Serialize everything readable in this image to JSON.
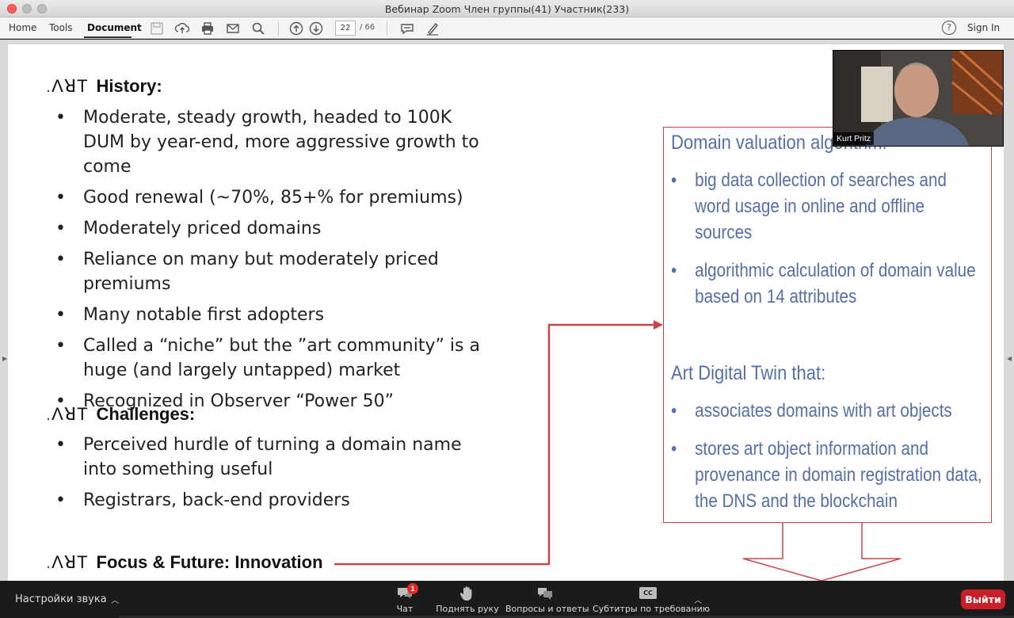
{
  "window": {
    "title": "Вебинар Zoom Член группы(41)  Участник(233)"
  },
  "toolbar": {
    "home": "Home",
    "tools": "Tools",
    "document": "Document",
    "page_current": "22",
    "page_total": "/ 66",
    "help": "?",
    "sign_in": "Sign In"
  },
  "slide": {
    "logo_text": "ΛꓤT",
    "history": {
      "heading": "History:",
      "bullets": [
        "Moderate, steady growth, headed to 100K DUM by year-end, more aggressive growth to come",
        "Good renewal (~70%, 85+% for premiums)",
        "Moderately priced domains",
        "Reliance on many but moderately priced premiums",
        "Many notable first adopters",
        "Called a “niche” but the ”art community” is a huge (and largely untapped) market",
        "Recognized in Observer “Power 50”"
      ]
    },
    "challenges": {
      "heading": "Challenges:",
      "bullets": [
        "Perceived hurdle of turning a domain name into something useful",
        "Registrars, back-end providers"
      ]
    },
    "focus": {
      "heading": "Focus & Future: Innovation"
    },
    "box": {
      "heading1": "Domain valuation algorithm:",
      "list1": [
        "big data collection of searches and word usage in online and offline sources",
        "algorithmic calculation of domain value based on 14 attributes"
      ],
      "heading2": "Art Digital Twin that:",
      "list2": [
        "associates domains with art objects",
        "stores art object information and provenance in domain registration data, the DNS and the blockchain"
      ]
    }
  },
  "video": {
    "participant_name": "Kurt Pritz"
  },
  "zoom_bar": {
    "audio_settings": "Настройки звука",
    "chat": "Чат",
    "chat_badge": "1",
    "raise_hand": "Поднять руку",
    "qa": "Вопросы и ответы",
    "captions": "Субтитры по требованию",
    "captions_icon_text": "CC",
    "leave": "Выйти"
  },
  "colors": {
    "accent_red": "#c9474b",
    "box_text_blue": "#5570a8",
    "leave_red": "#c91f28"
  }
}
